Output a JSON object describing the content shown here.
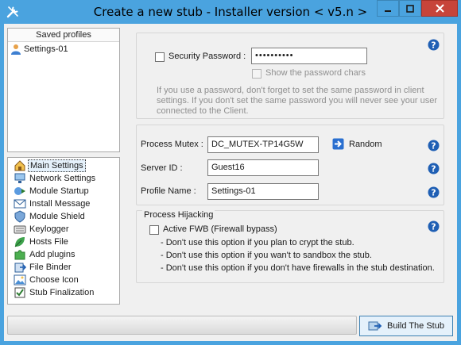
{
  "window": {
    "title": "Create a new stub - Installer version < v5.n >"
  },
  "profiles": {
    "header": "Saved profiles",
    "items": [
      {
        "label": "Settings-01"
      }
    ]
  },
  "nav": {
    "selected_index": 0,
    "items": [
      {
        "label": "Main Settings",
        "icon": "house-icon"
      },
      {
        "label": "Network Settings",
        "icon": "network-icon"
      },
      {
        "label": "Module Startup",
        "icon": "startup-icon"
      },
      {
        "label": "Install Message",
        "icon": "message-icon"
      },
      {
        "label": "Module Shield",
        "icon": "shield-icon"
      },
      {
        "label": "Keylogger",
        "icon": "keyboard-icon"
      },
      {
        "label": "Hosts File",
        "icon": "leaf-icon"
      },
      {
        "label": "Add plugins",
        "icon": "puzzle-icon"
      },
      {
        "label": "File Binder",
        "icon": "binder-icon"
      },
      {
        "label": "Choose Icon",
        "icon": "image-icon"
      },
      {
        "label": "Stub Finalization",
        "icon": "finalize-icon"
      }
    ]
  },
  "security": {
    "password_label": "Security Password :",
    "password_checked": false,
    "password_value": "••••••••••",
    "show_chars_label": "Show the password chars",
    "show_chars_checked": false,
    "hint_lines": [
      "If you use a password, don't forget to set the same password in client",
      "settings. If you don't set the same password you will never see your user",
      "connected to the Client."
    ]
  },
  "identity": {
    "mutex_label": "Process Mutex :",
    "mutex_value": "DC_MUTEX-TP14G5W",
    "random_label": "Random",
    "server_id_label": "Server ID :",
    "server_id_value": "Guest16",
    "profile_name_label": "Profile Name :",
    "profile_name_value": "Settings-01"
  },
  "hijacking": {
    "group_title": "Process Hijacking",
    "fwb_label": "Active FWB (Firewall bypass)",
    "fwb_checked": false,
    "notes": [
      "- Don't use this option if you plan to crypt the stub.",
      "- Don't use this option if you wan't to sandbox the stub.",
      "- Don't use this option if you don't have firewalls in the stub destination."
    ]
  },
  "footer": {
    "progress_percent": 0,
    "build_label": "Build The Stub"
  },
  "colors": {
    "titlebar": "#4aa3df",
    "close_button": "#c7443a",
    "help_icon": "#1f5fb4",
    "selection": "#e5f1fb"
  }
}
